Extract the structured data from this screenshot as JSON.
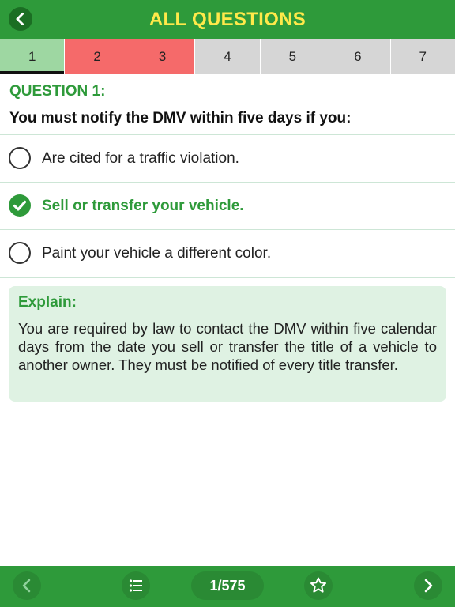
{
  "header": {
    "title": "ALL QUESTIONS",
    "back_icon": "chevron-left-icon"
  },
  "tabs": [
    {
      "label": "1",
      "state": "current"
    },
    {
      "label": "2",
      "state": "wrong"
    },
    {
      "label": "3",
      "state": "wrong"
    },
    {
      "label": "4",
      "state": "unanswered"
    },
    {
      "label": "5",
      "state": "unanswered"
    },
    {
      "label": "6",
      "state": "unanswered"
    },
    {
      "label": "7",
      "state": "unanswered"
    }
  ],
  "question": {
    "label": "QUESTION 1:",
    "text": "You must notify the DMV within five days if you:",
    "options": [
      {
        "text": "Are cited for a traffic violation.",
        "selected": false
      },
      {
        "text": "Sell or transfer your vehicle.",
        "selected": true
      },
      {
        "text": "Paint your vehicle a different color.",
        "selected": false
      }
    ]
  },
  "explain": {
    "title": "Explain:",
    "body": "You are required by law to contact the DMV within five calendar days from the date you sell or transfer the title of a vehicle to another owner. They must be notified of every title transfer."
  },
  "footer": {
    "counter": "1/575",
    "prev_icon": "chevron-left-icon",
    "list_icon": "list-icon",
    "star_icon": "star-icon",
    "next_icon": "chevron-right-icon"
  },
  "colors": {
    "brand_green": "#2e9a3a",
    "title_yellow": "#ffe94a",
    "tab_current": "#9ed7a2",
    "tab_wrong": "#f56a6a",
    "tab_unanswered": "#d6d6d6",
    "explain_bg": "#dff2e3"
  }
}
